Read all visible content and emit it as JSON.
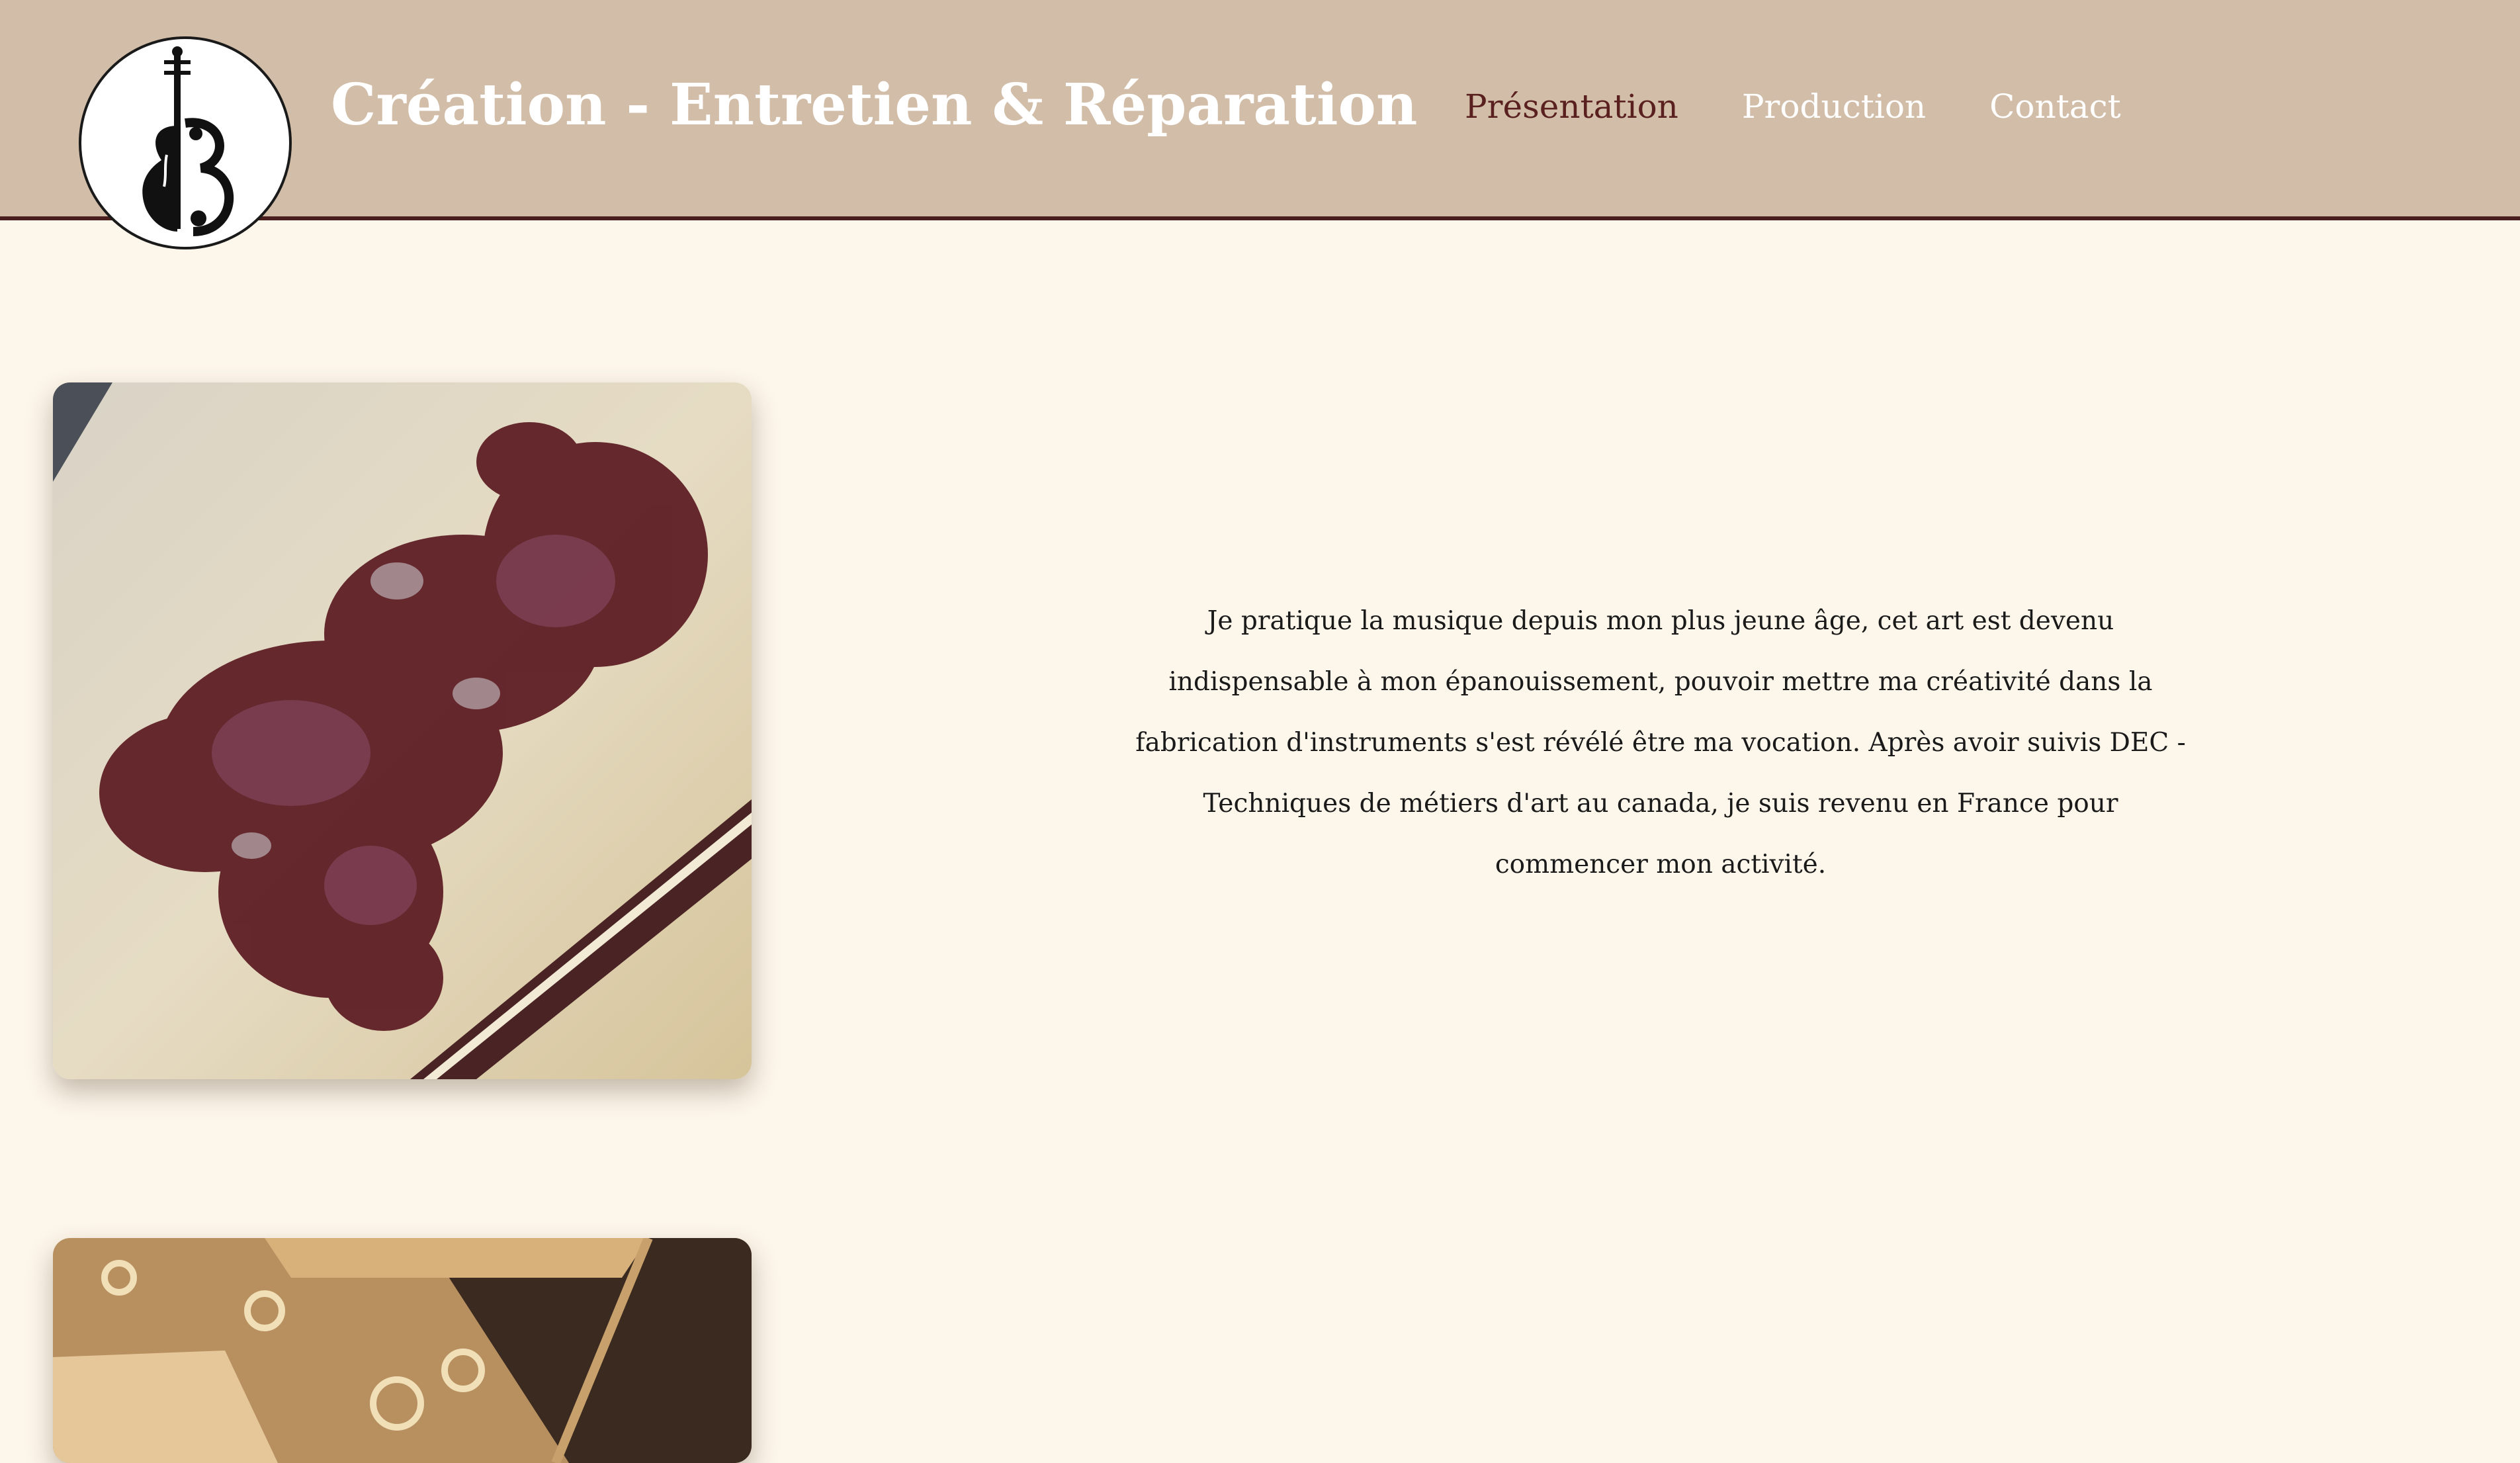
{
  "header": {
    "title": "Création - Entretien & Réparation",
    "logo_icon": "violin-b-monogram-icon",
    "background_color": "#d2bea8",
    "border_color": "#4b1e1e"
  },
  "nav": {
    "items": [
      {
        "label": "Présentation",
        "active": true
      },
      {
        "label": "Production",
        "active": false
      },
      {
        "label": "Contact",
        "active": false
      }
    ],
    "active_color": "#5a1f1f",
    "inactive_color": "#ffffff"
  },
  "main": {
    "intro_text": "Je pratique la musique depuis mon plus jeune âge, cet art est devenu indispensable à mon épanouissement, pouvoir mettre ma créativité dans la fabrication d'instruments s'est révélé être ma vocation. Après avoir suivis DEC - Techniques de métiers d'art au canada, je suis revenu en France pour commencer mon activité.",
    "background_color": "#fdf6ea"
  },
  "gallery": {
    "images": [
      {
        "name": "wood-shavings-dark-photo"
      },
      {
        "name": "wood-shavings-workbench-photo"
      }
    ]
  }
}
